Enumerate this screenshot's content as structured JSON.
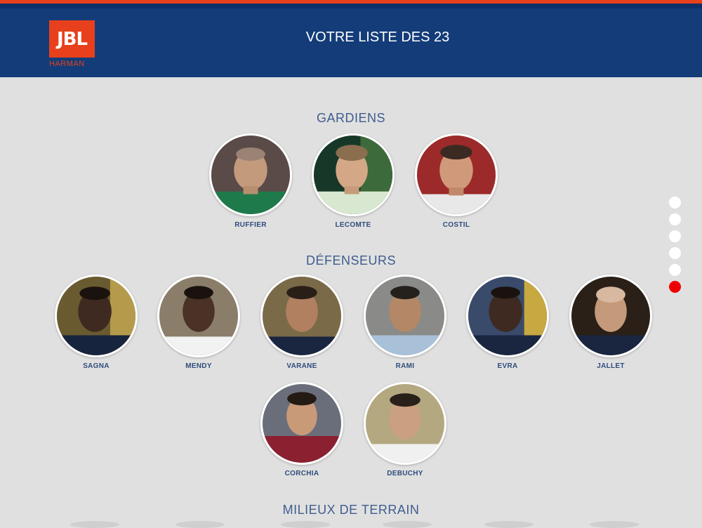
{
  "header": {
    "logo_text": "JBL",
    "logo_sub": "HARMAN",
    "title": "VOTRE LISTE DES 23"
  },
  "sections": {
    "gardiens": "GARDIENS",
    "defenseurs": "DÉFENSEURS",
    "milieux": "MILIEUX DE TERRAIN"
  },
  "gardiens": [
    "RUFFIER",
    "LECOMTE",
    "COSTIL"
  ],
  "defenseurs": [
    "SAGNA",
    "MENDY",
    "VARANE",
    "RAMI",
    "EVRA",
    "JALLET",
    "CORCHIA",
    "DEBUCHY"
  ],
  "colors": {
    "header": "#133c78",
    "accent": "#e8401c",
    "active_dot": "#ee0000"
  },
  "pagination": {
    "total": 6,
    "active": 6
  }
}
